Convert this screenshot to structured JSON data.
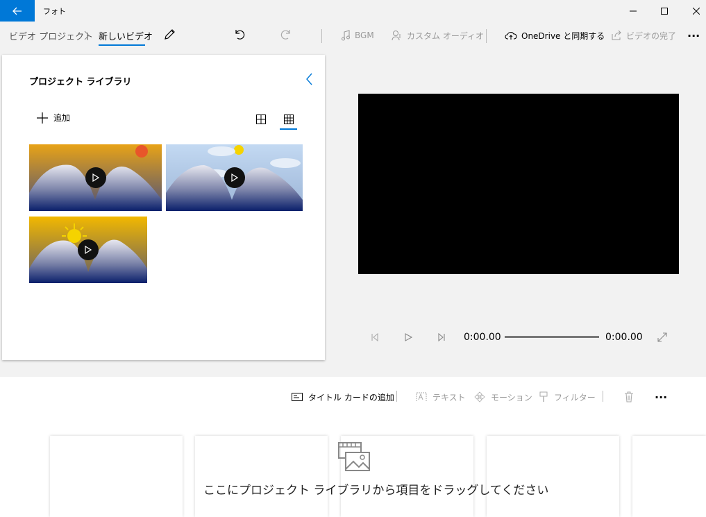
{
  "window": {
    "title": "フォト",
    "back_icon": "arrow-left-icon",
    "controls": [
      "minimize-icon",
      "maximize-icon",
      "close-icon"
    ]
  },
  "toolbar": {
    "breadcrumb_parent": "ビデオ プロジェクト",
    "breadcrumb_current": "新しいビデオ",
    "bgm_label": "BGM",
    "custom_audio_label": "カスタム オーディオ",
    "onedrive_label": "OneDrive と同期する",
    "finish_label": "ビデオの完了",
    "more_label": "···"
  },
  "library": {
    "title": "プロジェクト ライブラリ",
    "add_label": "追加",
    "items": [
      {
        "theme": "sunset",
        "accent": "#e8a317"
      },
      {
        "theme": "cloudy",
        "accent": "#c3d9f2"
      },
      {
        "theme": "sunny",
        "accent": "#f2b800"
      }
    ]
  },
  "player": {
    "current_time": "0:00.00",
    "total_time": "0:00.00",
    "progress": 0
  },
  "storyboard": {
    "add_title_card_label": "タイトル カードの追加",
    "text_label": "テキスト",
    "motion_label": "モーション",
    "filter_label": "フィルター",
    "more_label": "···",
    "drop_hint": "ここにプロジェクト ライブラリから項目をドラッグしてください"
  },
  "colors": {
    "accent": "#0078d7",
    "disabled_text": "#999999"
  }
}
